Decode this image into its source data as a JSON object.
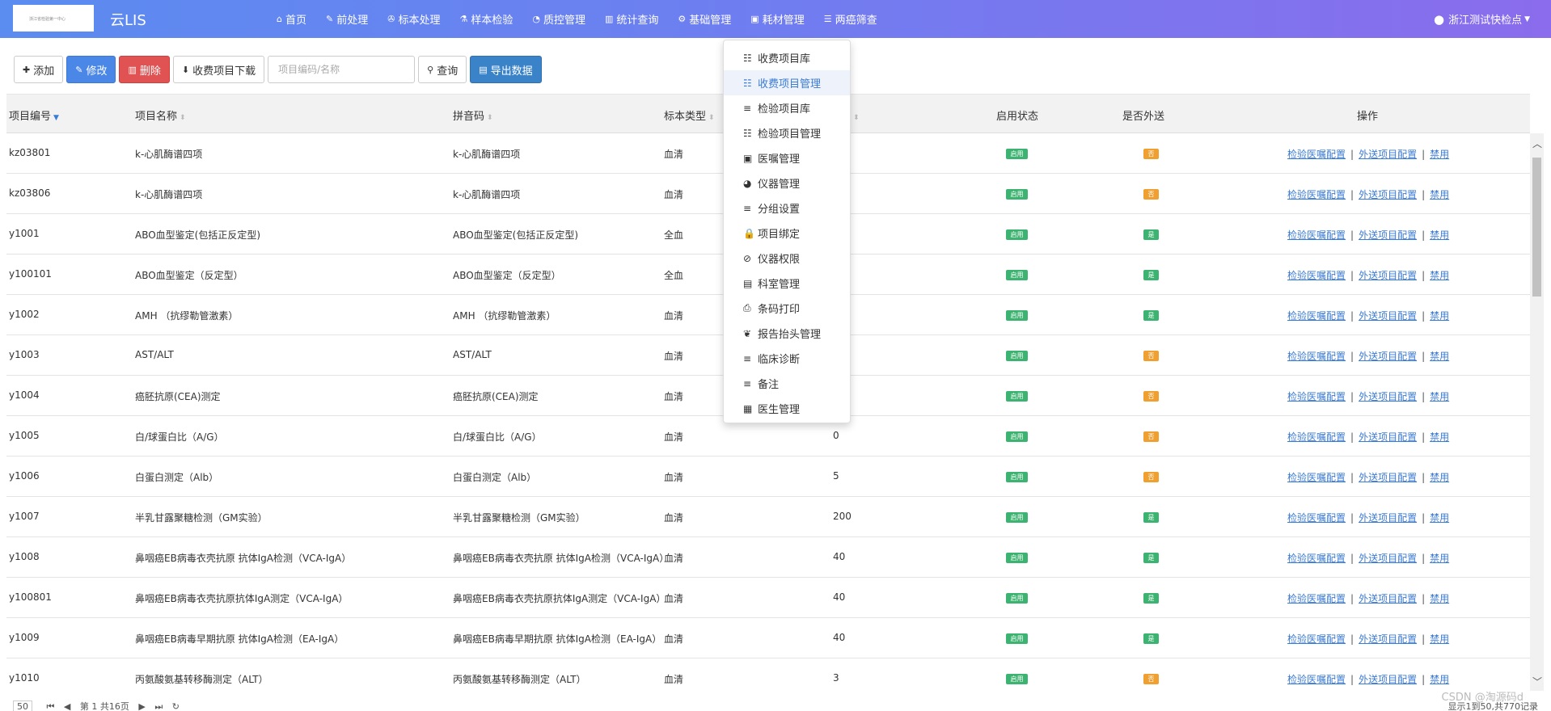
{
  "app": {
    "brand": "云LIS",
    "logo_text": "浙江省检验第一中心",
    "user": "浙江测试快检点"
  },
  "nav": [
    {
      "icon": "home-icon",
      "glyph": "⌂",
      "label": "首页"
    },
    {
      "icon": "wrench-icon",
      "glyph": "✎",
      "label": "前处理"
    },
    {
      "icon": "pipette-icon",
      "glyph": "✇",
      "label": "标本处理"
    },
    {
      "icon": "flask-icon",
      "glyph": "⚗",
      "label": "样本检验"
    },
    {
      "icon": "pie-chart-icon",
      "glyph": "◔",
      "label": "质控管理"
    },
    {
      "icon": "bar-chart-icon",
      "glyph": "▥",
      "label": "统计查询"
    },
    {
      "icon": "gear-icon",
      "glyph": "⚙",
      "label": "基础管理"
    },
    {
      "icon": "briefcase-icon",
      "glyph": "▣",
      "label": "耗材管理"
    },
    {
      "icon": "list-icon",
      "glyph": "☰",
      "label": "两癌筛查"
    }
  ],
  "toolbar": {
    "add": "添加",
    "edit": "修改",
    "delete": "删除",
    "download": "收费项目下载",
    "search_placeholder": "项目编码/名称",
    "query": "查询",
    "export": "导出数据"
  },
  "columns": {
    "code": "项目编号",
    "name": "项目名称",
    "pinyin": "拼音码",
    "sample_type": "标本类型",
    "price": "单价",
    "enabled": "启用状态",
    "outsourced": "是否外送",
    "actions": "操作"
  },
  "rows": [
    {
      "code": "kz03801",
      "name": "k-心肌酶谱四项",
      "pinyin": "k-心肌酶谱四项",
      "sample": "血清",
      "price": "",
      "enabled": "启用",
      "out": "否",
      "out_color": "orange"
    },
    {
      "code": "kz03806",
      "name": "k-心肌酶谱四项",
      "pinyin": "k-心肌酶谱四项",
      "sample": "血清",
      "price": "",
      "enabled": "启用",
      "out": "否",
      "out_color": "orange"
    },
    {
      "code": "y1001",
      "name": "ABO血型鉴定(包括正反定型)",
      "pinyin": "ABO血型鉴定(包括正反定型)",
      "sample": "全血",
      "price": "",
      "enabled": "启用",
      "out": "是",
      "out_color": "green"
    },
    {
      "code": "y100101",
      "name": "ABO血型鉴定（反定型）",
      "pinyin": "ABO血型鉴定（反定型）",
      "sample": "全血",
      "price": "",
      "enabled": "启用",
      "out": "是",
      "out_color": "green"
    },
    {
      "code": "y1002",
      "name": "AMH （抗缪勒管激素）",
      "pinyin": "AMH （抗缪勒管激素）",
      "sample": "血清",
      "price": "",
      "enabled": "启用",
      "out": "是",
      "out_color": "green"
    },
    {
      "code": "y1003",
      "name": "AST/ALT",
      "pinyin": "AST/ALT",
      "sample": "血清",
      "price": "",
      "enabled": "启用",
      "out": "否",
      "out_color": "orange"
    },
    {
      "code": "y1004",
      "name": "癌胚抗原(CEA)测定",
      "pinyin": "癌胚抗原(CEA)测定",
      "sample": "血清",
      "price": "",
      "enabled": "启用",
      "out": "否",
      "out_color": "orange"
    },
    {
      "code": "y1005",
      "name": "白/球蛋白比（A/G）",
      "pinyin": "白/球蛋白比（A/G）",
      "sample": "血清",
      "price": "0",
      "enabled": "启用",
      "out": "否",
      "out_color": "orange"
    },
    {
      "code": "y1006",
      "name": "白蛋白测定（Alb）",
      "pinyin": "白蛋白测定（Alb）",
      "sample": "血清",
      "price": "5",
      "enabled": "启用",
      "out": "否",
      "out_color": "orange"
    },
    {
      "code": "y1007",
      "name": "半乳甘露聚糖检测（GM实验）",
      "pinyin": "半乳甘露聚糖检测（GM实验）",
      "sample": "血清",
      "price": "200",
      "enabled": "启用",
      "out": "是",
      "out_color": "green"
    },
    {
      "code": "y1008",
      "name": "鼻咽癌EB病毒衣壳抗原 抗体IgA检测（VCA-IgA）",
      "pinyin": "鼻咽癌EB病毒衣壳抗原 抗体IgA检测（VCA-IgA）",
      "sample": "血清",
      "price": "40",
      "enabled": "启用",
      "out": "是",
      "out_color": "green"
    },
    {
      "code": "y100801",
      "name": "鼻咽癌EB病毒衣壳抗原抗体IgA测定（VCA-IgA）",
      "pinyin": "鼻咽癌EB病毒衣壳抗原抗体IgA测定（VCA-IgA）",
      "sample": "血清",
      "price": "40",
      "enabled": "启用",
      "out": "是",
      "out_color": "green"
    },
    {
      "code": "y1009",
      "name": "鼻咽癌EB病毒早期抗原 抗体IgA检测（EA-IgA）",
      "pinyin": "鼻咽癌EB病毒早期抗原 抗体IgA检测（EA-IgA）",
      "sample": "血清",
      "price": "40",
      "enabled": "启用",
      "out": "是",
      "out_color": "green"
    },
    {
      "code": "y1010",
      "name": "丙氨酸氨基转移酶测定（ALT）",
      "pinyin": "丙氨酸氨基转移酶测定（ALT）",
      "sample": "血清",
      "price": "3",
      "enabled": "启用",
      "out": "否",
      "out_color": "orange"
    }
  ],
  "row_actions": {
    "config": "检验医嘱配置",
    "outsource": "外送项目配置",
    "disable": "禁用"
  },
  "dropdown": [
    {
      "icon": "list-icon",
      "glyph": "☷",
      "label": "收费项目库",
      "active": false
    },
    {
      "icon": "list-icon",
      "glyph": "☷",
      "label": "收费项目管理",
      "active": true
    },
    {
      "icon": "bars-icon",
      "glyph": "≡",
      "label": "检验项目库",
      "active": false
    },
    {
      "icon": "list-ol-icon",
      "glyph": "☷",
      "label": "检验项目管理",
      "active": false
    },
    {
      "icon": "medkit-icon",
      "glyph": "▣",
      "label": "医嘱管理",
      "active": false
    },
    {
      "icon": "dashboard-icon",
      "glyph": "◕",
      "label": "仪器管理",
      "active": false
    },
    {
      "icon": "bars-icon",
      "glyph": "≡",
      "label": "分组设置",
      "active": false
    },
    {
      "icon": "lock-icon",
      "glyph": "🔒",
      "label": "项目绑定",
      "active": false
    },
    {
      "icon": "ban-icon",
      "glyph": "⊘",
      "label": "仪器权限",
      "active": false
    },
    {
      "icon": "clipboard-icon",
      "glyph": "▤",
      "label": "科室管理",
      "active": false
    },
    {
      "icon": "print-icon",
      "glyph": "⎙",
      "label": "条码打印",
      "active": false
    },
    {
      "icon": "leaf-icon",
      "glyph": "❦",
      "label": "报告抬头管理",
      "active": false
    },
    {
      "icon": "bars-icon",
      "glyph": "≡",
      "label": "临床诊断",
      "active": false
    },
    {
      "icon": "bars-icon",
      "glyph": "≡",
      "label": "备注",
      "active": false
    },
    {
      "icon": "id-card-icon",
      "glyph": "▦",
      "label": "医生管理",
      "active": false
    }
  ],
  "pager": {
    "page_size": "50",
    "text": "第 1 共16页",
    "records": "显示1到50,共770记录"
  },
  "watermark": "CSDN @淘源码d",
  "colors": {
    "nav_gradient_start": "#5b8cf0",
    "nav_gradient_end": "#8a6cec",
    "primary": "#4a87e7",
    "danger": "#e05352",
    "enabled_badge": "#3cb371",
    "outsource_no_badge": "#f0a030",
    "link": "#3a7bd5"
  }
}
